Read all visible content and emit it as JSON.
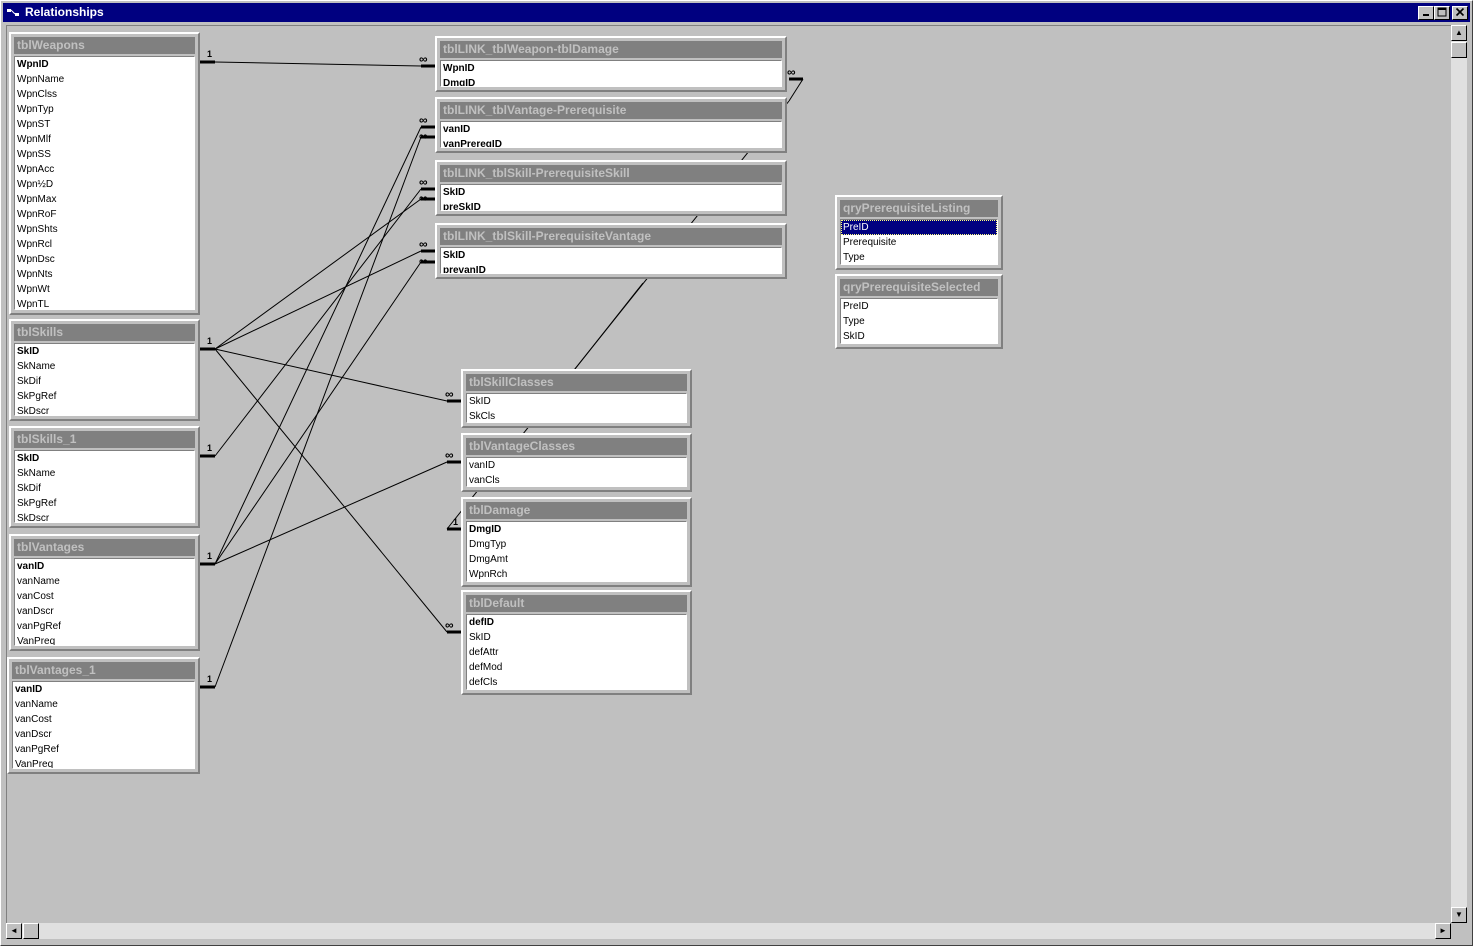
{
  "window": {
    "title": "Relationships",
    "controls": [
      "minimize",
      "maximize",
      "close"
    ]
  },
  "tables": [
    {
      "name": "tblWeapons",
      "fields": [
        {
          "label": "WpnID",
          "key": true
        },
        {
          "label": "WpnName"
        },
        {
          "label": "WpnClss"
        },
        {
          "label": "WpnTyp"
        },
        {
          "label": "WpnST"
        },
        {
          "label": "WpnMlf"
        },
        {
          "label": "WpnSS"
        },
        {
          "label": "WpnAcc"
        },
        {
          "label": "Wpn½D"
        },
        {
          "label": "WpnMax"
        },
        {
          "label": "WpnRoF"
        },
        {
          "label": "WpnShts"
        },
        {
          "label": "WpnRcl"
        },
        {
          "label": "WpnDsc"
        },
        {
          "label": "WpnNts"
        },
        {
          "label": "WpnWt"
        },
        {
          "label": "WpnTL"
        }
      ]
    },
    {
      "name": "tblSkills",
      "fields": [
        {
          "label": "SkID",
          "key": true
        },
        {
          "label": "SkName"
        },
        {
          "label": "SkDif"
        },
        {
          "label": "SkPgRef"
        },
        {
          "label": "SkDscr"
        }
      ]
    },
    {
      "name": "tblSkills_1",
      "fields": [
        {
          "label": "SkID",
          "key": true
        },
        {
          "label": "SkName"
        },
        {
          "label": "SkDif"
        },
        {
          "label": "SkPgRef"
        },
        {
          "label": "SkDscr"
        }
      ]
    },
    {
      "name": "tblVantages",
      "fields": [
        {
          "label": "vanID",
          "key": true
        },
        {
          "label": "vanName"
        },
        {
          "label": "vanCost"
        },
        {
          "label": "vanDscr"
        },
        {
          "label": "vanPgRef"
        },
        {
          "label": "VanPreq"
        }
      ]
    },
    {
      "name": "tblVantages_1",
      "fields": [
        {
          "label": "vanID",
          "key": true
        },
        {
          "label": "vanName"
        },
        {
          "label": "vanCost"
        },
        {
          "label": "vanDscr"
        },
        {
          "label": "vanPgRef"
        },
        {
          "label": "VanPreq"
        }
      ]
    },
    {
      "name": "tblLINK_tblWeapon-tblDamage",
      "fields": [
        {
          "label": "WpnID",
          "key": true
        },
        {
          "label": "DmgID",
          "key": true
        }
      ]
    },
    {
      "name": "tblLINK_tblVantage-Prerequisite",
      "fields": [
        {
          "label": "vanID",
          "key": true
        },
        {
          "label": "vanPrereqID",
          "key": true
        }
      ]
    },
    {
      "name": "tblLINK_tblSkill-PrerequisiteSkill",
      "fields": [
        {
          "label": "SkID",
          "key": true
        },
        {
          "label": "preSkID",
          "key": true
        }
      ]
    },
    {
      "name": "tblLINK_tblSkill-PrerequisiteVantage",
      "fields": [
        {
          "label": "SkID",
          "key": true
        },
        {
          "label": "prevanID",
          "key": true
        }
      ]
    },
    {
      "name": "tblSkillClasses",
      "fields": [
        {
          "label": "SkID"
        },
        {
          "label": "SkCls"
        }
      ]
    },
    {
      "name": "tblVantageClasses",
      "fields": [
        {
          "label": "vanID"
        },
        {
          "label": "vanCls"
        }
      ]
    },
    {
      "name": "tblDamage",
      "fields": [
        {
          "label": "DmgID",
          "key": true
        },
        {
          "label": "DmgTyp"
        },
        {
          "label": "DmgAmt"
        },
        {
          "label": "WpnRch"
        }
      ]
    },
    {
      "name": "tblDefault",
      "fields": [
        {
          "label": "defID",
          "key": true
        },
        {
          "label": "SkID"
        },
        {
          "label": "defAttr"
        },
        {
          "label": "defMod"
        },
        {
          "label": "defCls"
        }
      ]
    },
    {
      "name": "qryPrerequisiteListing",
      "fields": [
        {
          "label": "PreID",
          "selected": true
        },
        {
          "label": "Prerequisite"
        },
        {
          "label": "Type"
        }
      ]
    },
    {
      "name": "qryPrerequisiteSelected",
      "fields": [
        {
          "label": "PreID"
        },
        {
          "label": "Type"
        },
        {
          "label": "SkID"
        }
      ]
    }
  ],
  "cardinality": {
    "one": "1",
    "many": "∞"
  },
  "scrollbars": {
    "up": "▲",
    "down": "▼",
    "left": "◄",
    "right": "►"
  }
}
